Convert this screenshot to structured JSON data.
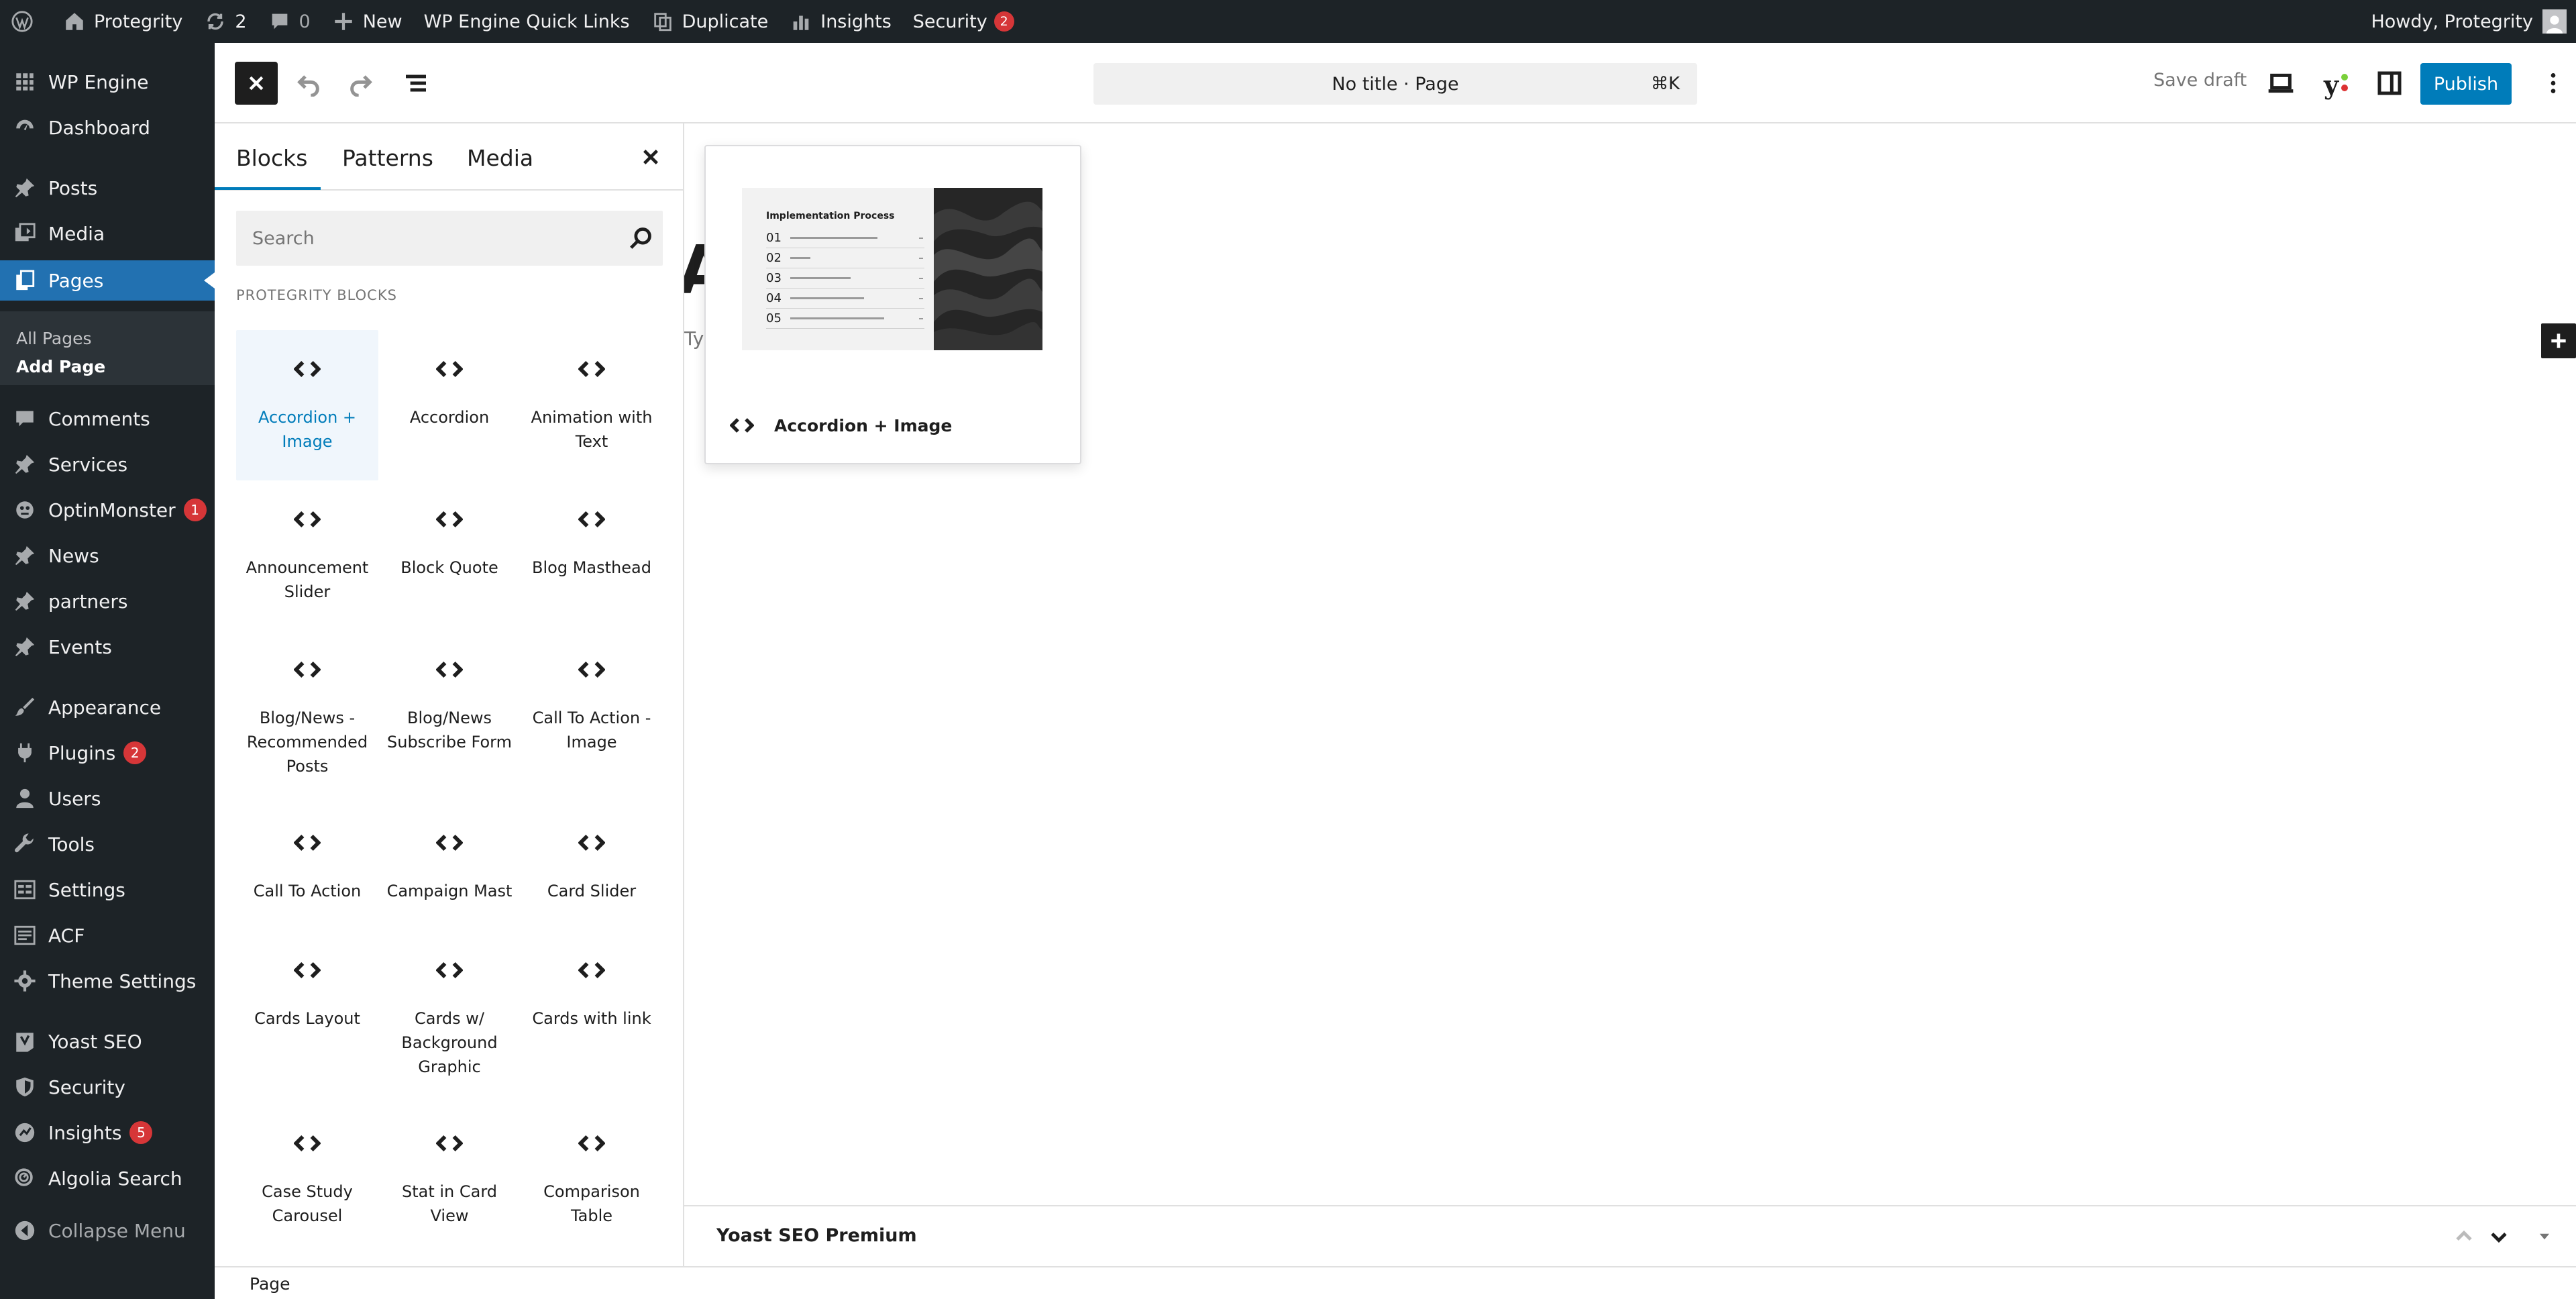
{
  "admin_bar": {
    "site_name": "Protegrity",
    "updates_count": "2",
    "comments_count": "0",
    "new_label": "New",
    "quick_links": "WP Engine Quick Links",
    "duplicate": "Duplicate",
    "insights": "Insights",
    "security": "Security",
    "security_badge": "2",
    "howdy": "Howdy, Protegrity"
  },
  "admin_menu": {
    "items": [
      {
        "label": "WP Engine",
        "icon": "grid-icon"
      },
      {
        "label": "Dashboard",
        "icon": "dashboard-icon"
      },
      {
        "label": "Posts",
        "icon": "pin-icon"
      },
      {
        "label": "Media",
        "icon": "media-icon"
      },
      {
        "label": "Pages",
        "icon": "pages-icon"
      },
      {
        "label": "Comments",
        "icon": "comment-icon"
      },
      {
        "label": "Services",
        "icon": "pin-icon"
      },
      {
        "label": "OptinMonster",
        "icon": "optinmonster-icon",
        "badge": "1"
      },
      {
        "label": "News",
        "icon": "pin-icon"
      },
      {
        "label": "partners",
        "icon": "pin-icon"
      },
      {
        "label": "Events",
        "icon": "pin-icon"
      },
      {
        "label": "Appearance",
        "icon": "brush-icon"
      },
      {
        "label": "Plugins",
        "icon": "plugin-icon",
        "badge": "2"
      },
      {
        "label": "Users",
        "icon": "user-icon"
      },
      {
        "label": "Tools",
        "icon": "wrench-icon"
      },
      {
        "label": "Settings",
        "icon": "settings-icon"
      },
      {
        "label": "ACF",
        "icon": "acf-icon"
      },
      {
        "label": "Theme Settings",
        "icon": "gear-icon"
      },
      {
        "label": "Yoast SEO",
        "icon": "yoast-icon"
      },
      {
        "label": "Security",
        "icon": "shield-icon"
      },
      {
        "label": "Insights",
        "icon": "insights-icon",
        "badge": "5"
      },
      {
        "label": "Algolia Search",
        "icon": "algolia-icon"
      },
      {
        "label": "Collapse Menu",
        "icon": "collapse-icon"
      }
    ],
    "submenu": [
      "All Pages",
      "Add Page"
    ]
  },
  "header": {
    "command_bar": "No title · Page",
    "command_shortcut": "⌘K",
    "save_draft": "Save draft",
    "publish": "Publish"
  },
  "inserter": {
    "tabs": [
      "Blocks",
      "Patterns",
      "Media"
    ],
    "search_placeholder": "Search",
    "category": "PROTEGRITY BLOCKS",
    "blocks": [
      "Accordion + Image",
      "Accordion",
      "Animation with Text",
      "Announcement Slider",
      "Block Quote",
      "Blog Masthead",
      "Blog/News - Recommended Posts",
      "Blog/News Subscribe Form",
      "Call To Action - Image",
      "Call To Action",
      "Campaign Mast",
      "Card Slider",
      "Cards Layout",
      "Cards w/ Background Graphic",
      "Cards with link",
      "Case Study Carousel",
      "Stat in Card View",
      "Comparison Table"
    ]
  },
  "canvas": {
    "title_fragment": "A",
    "text_fragment": "Ty"
  },
  "preview": {
    "block_name": "Accordion + Image",
    "thumb_title": "Implementation Process",
    "thumb_rows": [
      "01",
      "02",
      "03",
      "04",
      "05"
    ]
  },
  "metabox": {
    "title": "Yoast SEO Premium"
  },
  "footer": {
    "breadcrumb": "Page"
  },
  "colors": {
    "admin_bg": "#1d2327",
    "accent": "#007cba",
    "menu_current": "#2271b1",
    "badge": "#d63638"
  }
}
